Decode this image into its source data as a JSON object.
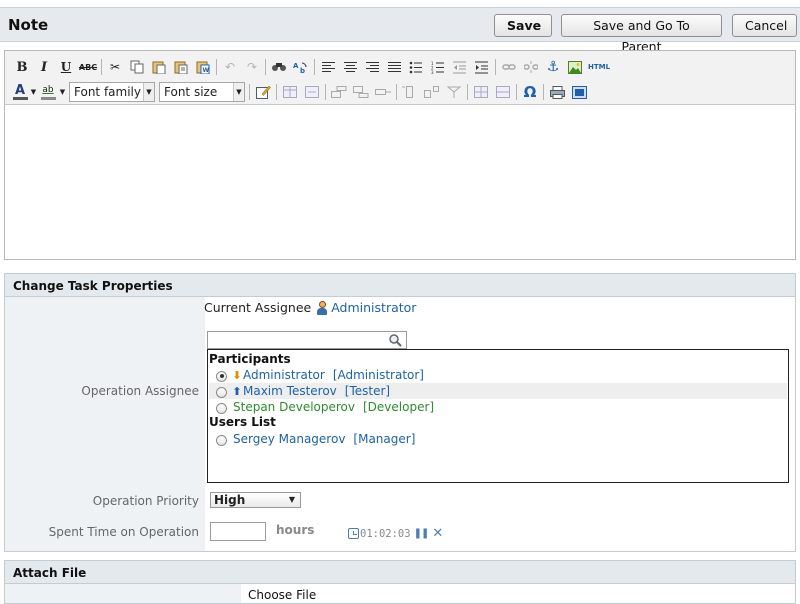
{
  "header": {
    "title": "Note",
    "save_label": "Save",
    "save_parent_label": "Save and Go To Parent",
    "cancel_label": "Cancel"
  },
  "editor": {
    "toolbar": {
      "bold": "B",
      "italic": "I",
      "underline": "U",
      "strikethrough": "ABC",
      "html": "HTML",
      "text_color": "A",
      "highlight": "ab",
      "font_family": "Font family",
      "font_size": "Font size",
      "special_char": "Ω"
    },
    "content": ""
  },
  "task_props": {
    "title": "Change Task Properties",
    "current_assignee_label": "Current Assignee",
    "current_assignee": "Administrator",
    "operation_assignee_label": "Operation Assignee",
    "search_placeholder": "",
    "groups": [
      {
        "name": "Participants",
        "items": [
          {
            "name": "Administrator",
            "role": "[Administrator]",
            "selected": true,
            "arrow": "down",
            "color": "#1e62a3"
          },
          {
            "name": "Maxim Testerov",
            "role": "[Tester]",
            "selected": false,
            "arrow": "up",
            "color": "#1e62a3"
          },
          {
            "name": "Stepan Developerov",
            "role": "[Developer]",
            "selected": false,
            "arrow": "",
            "color": "#2e8b2e"
          }
        ]
      },
      {
        "name": "Users List",
        "items": [
          {
            "name": "Sergey Managerov",
            "role": "[Manager]",
            "selected": false,
            "arrow": "",
            "color": "#1e62a3"
          }
        ]
      }
    ],
    "priority_label": "Operation Priority",
    "priority_value": "High",
    "spent_time_label": "Spent Time on Operation",
    "hours_value": "",
    "hours_unit": "hours",
    "timer": "01:02:03"
  },
  "attach": {
    "title": "Attach File",
    "choose_file_label": "Choose File"
  },
  "colors": {
    "link": "#1e62a3",
    "developer": "#2e8b2e",
    "panel_header_bg": "#e4e9ed",
    "label_col_bg": "#eef2f5"
  }
}
